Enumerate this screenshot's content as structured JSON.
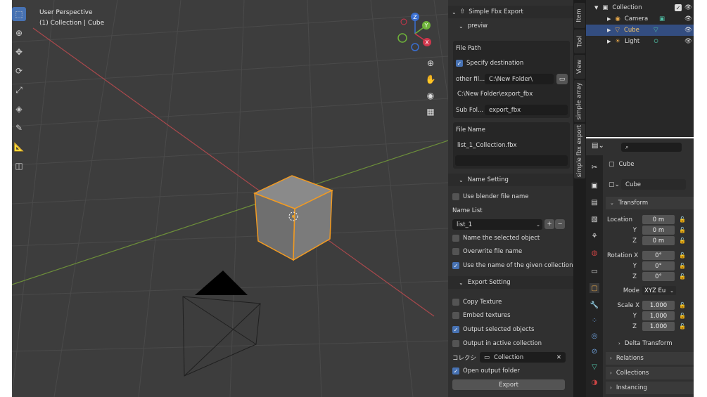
{
  "viewport": {
    "perspective": "User Perspective",
    "context": "(1) Collection | Cube",
    "gizmo": {
      "x": "X",
      "y": "Y",
      "z": "Z"
    },
    "tools": [
      "select-icon",
      "cursor-icon",
      "move-icon",
      "rotate-icon",
      "scale-icon",
      "transform-icon",
      "annotate-icon",
      "measure-icon",
      "add-cube-icon"
    ],
    "nav": [
      "zoom-icon",
      "hand-icon",
      "camera-icon",
      "grid-icon"
    ]
  },
  "npanel": {
    "title": "Simple Fbx Export",
    "previw": "previw",
    "file_path": {
      "header": "File Path",
      "specify_destination": "Specify destination",
      "other_label": "other fil...",
      "other_value": "C:\\New Folder\\",
      "full_path": "C:\\New Folder\\export_fbx",
      "sub_label": "Sub Fol...",
      "sub_value": "export_fbx"
    },
    "file_name": {
      "header": "File Name",
      "value": "list_1_Collection.fbx"
    },
    "name_setting": {
      "header": "Name Setting",
      "use_blender": "Use blender file name",
      "name_list_label": "Name List",
      "name_list_value": "list_1",
      "name_selected": "Name the selected object",
      "overwrite": "Overwrite file name",
      "use_collection": "Use the name of the given collection"
    },
    "export_setting": {
      "header": "Export Setting",
      "copy_texture": "Copy Texture",
      "embed": "Embed textures",
      "output_selected": "Output selected objects",
      "output_active": "Output in active collection",
      "collection_label": "コレクシ",
      "collection_value": "Collection",
      "open_folder": "Open output folder",
      "export_btn": "Export"
    }
  },
  "tabs": [
    "Item",
    "Tool",
    "View",
    "simple array",
    "simple fbx export"
  ],
  "outliner": {
    "rows": [
      {
        "name": "Collection"
      },
      {
        "name": "Camera"
      },
      {
        "name": "Cube"
      },
      {
        "name": "Light"
      }
    ]
  },
  "properties": {
    "object_name": "Cube",
    "data_name": "Cube",
    "transform": "Transform",
    "location_label": "Location",
    "rotation_label": "Rotation X",
    "mode_label": "Mode",
    "mode_value": "XYZ Eu",
    "scale_label": "Scale X",
    "axes": {
      "x": "X",
      "y": "Y",
      "z": "Z"
    },
    "location": [
      "0 m",
      "0 m",
      "0 m"
    ],
    "rotation": [
      "0°",
      "0°",
      "0°"
    ],
    "scale": [
      "1.000",
      "1.000",
      "1.000"
    ],
    "sections": [
      "Delta Transform",
      "Relations",
      "Collections",
      "Instancing"
    ]
  },
  "colors": {
    "accent": "#4772b3",
    "selected_outline": "#f39b21",
    "viewport_bg": "#3d3d3d"
  }
}
